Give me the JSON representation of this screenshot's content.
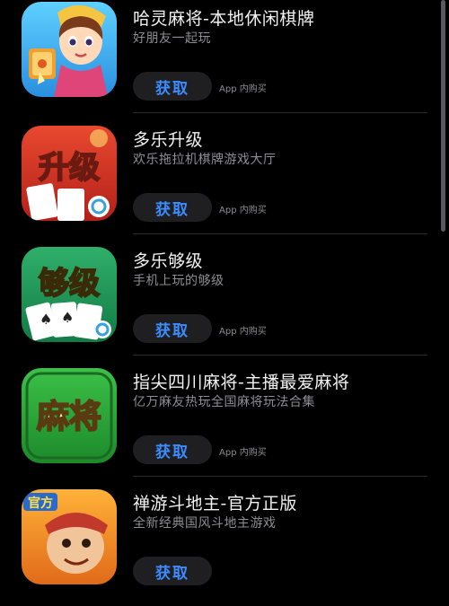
{
  "apps": [
    {
      "title": "哈灵麻将-本地休闲棋牌",
      "subtitle": "好朋友一起玩",
      "get_label": "获取",
      "iap_label": "App 内购买",
      "icon": "haling-mahjong-icon"
    },
    {
      "title": "多乐升级",
      "subtitle": "欢乐拖拉机棋牌游戏大厅",
      "get_label": "获取",
      "iap_label": "App 内购买",
      "icon": "duole-shengji-icon",
      "icon_text": "升级"
    },
    {
      "title": "多乐够级",
      "subtitle": "手机上玩的够级",
      "get_label": "获取",
      "iap_label": "App 内购买",
      "icon": "duole-gouji-icon",
      "icon_text": "够级"
    },
    {
      "title": "指尖四川麻将-主播最爱麻将",
      "subtitle": "亿万麻友热玩全国麻将玩法合集",
      "get_label": "获取",
      "iap_label": "App 内购买",
      "icon": "sichuan-mahjong-icon",
      "icon_text": "麻将"
    },
    {
      "title": "禅游斗地主-官方正版",
      "subtitle": "全新经典国风斗地主游戏",
      "get_label": "获取",
      "iap_label": "App 内购买",
      "icon": "chanyou-doudizhu-icon",
      "icon_text": "官方"
    }
  ],
  "colors": {
    "background": "#000000",
    "button_bg": "#1f1f22",
    "button_text": "#3b8cff",
    "subtitle": "#8d8d92"
  }
}
